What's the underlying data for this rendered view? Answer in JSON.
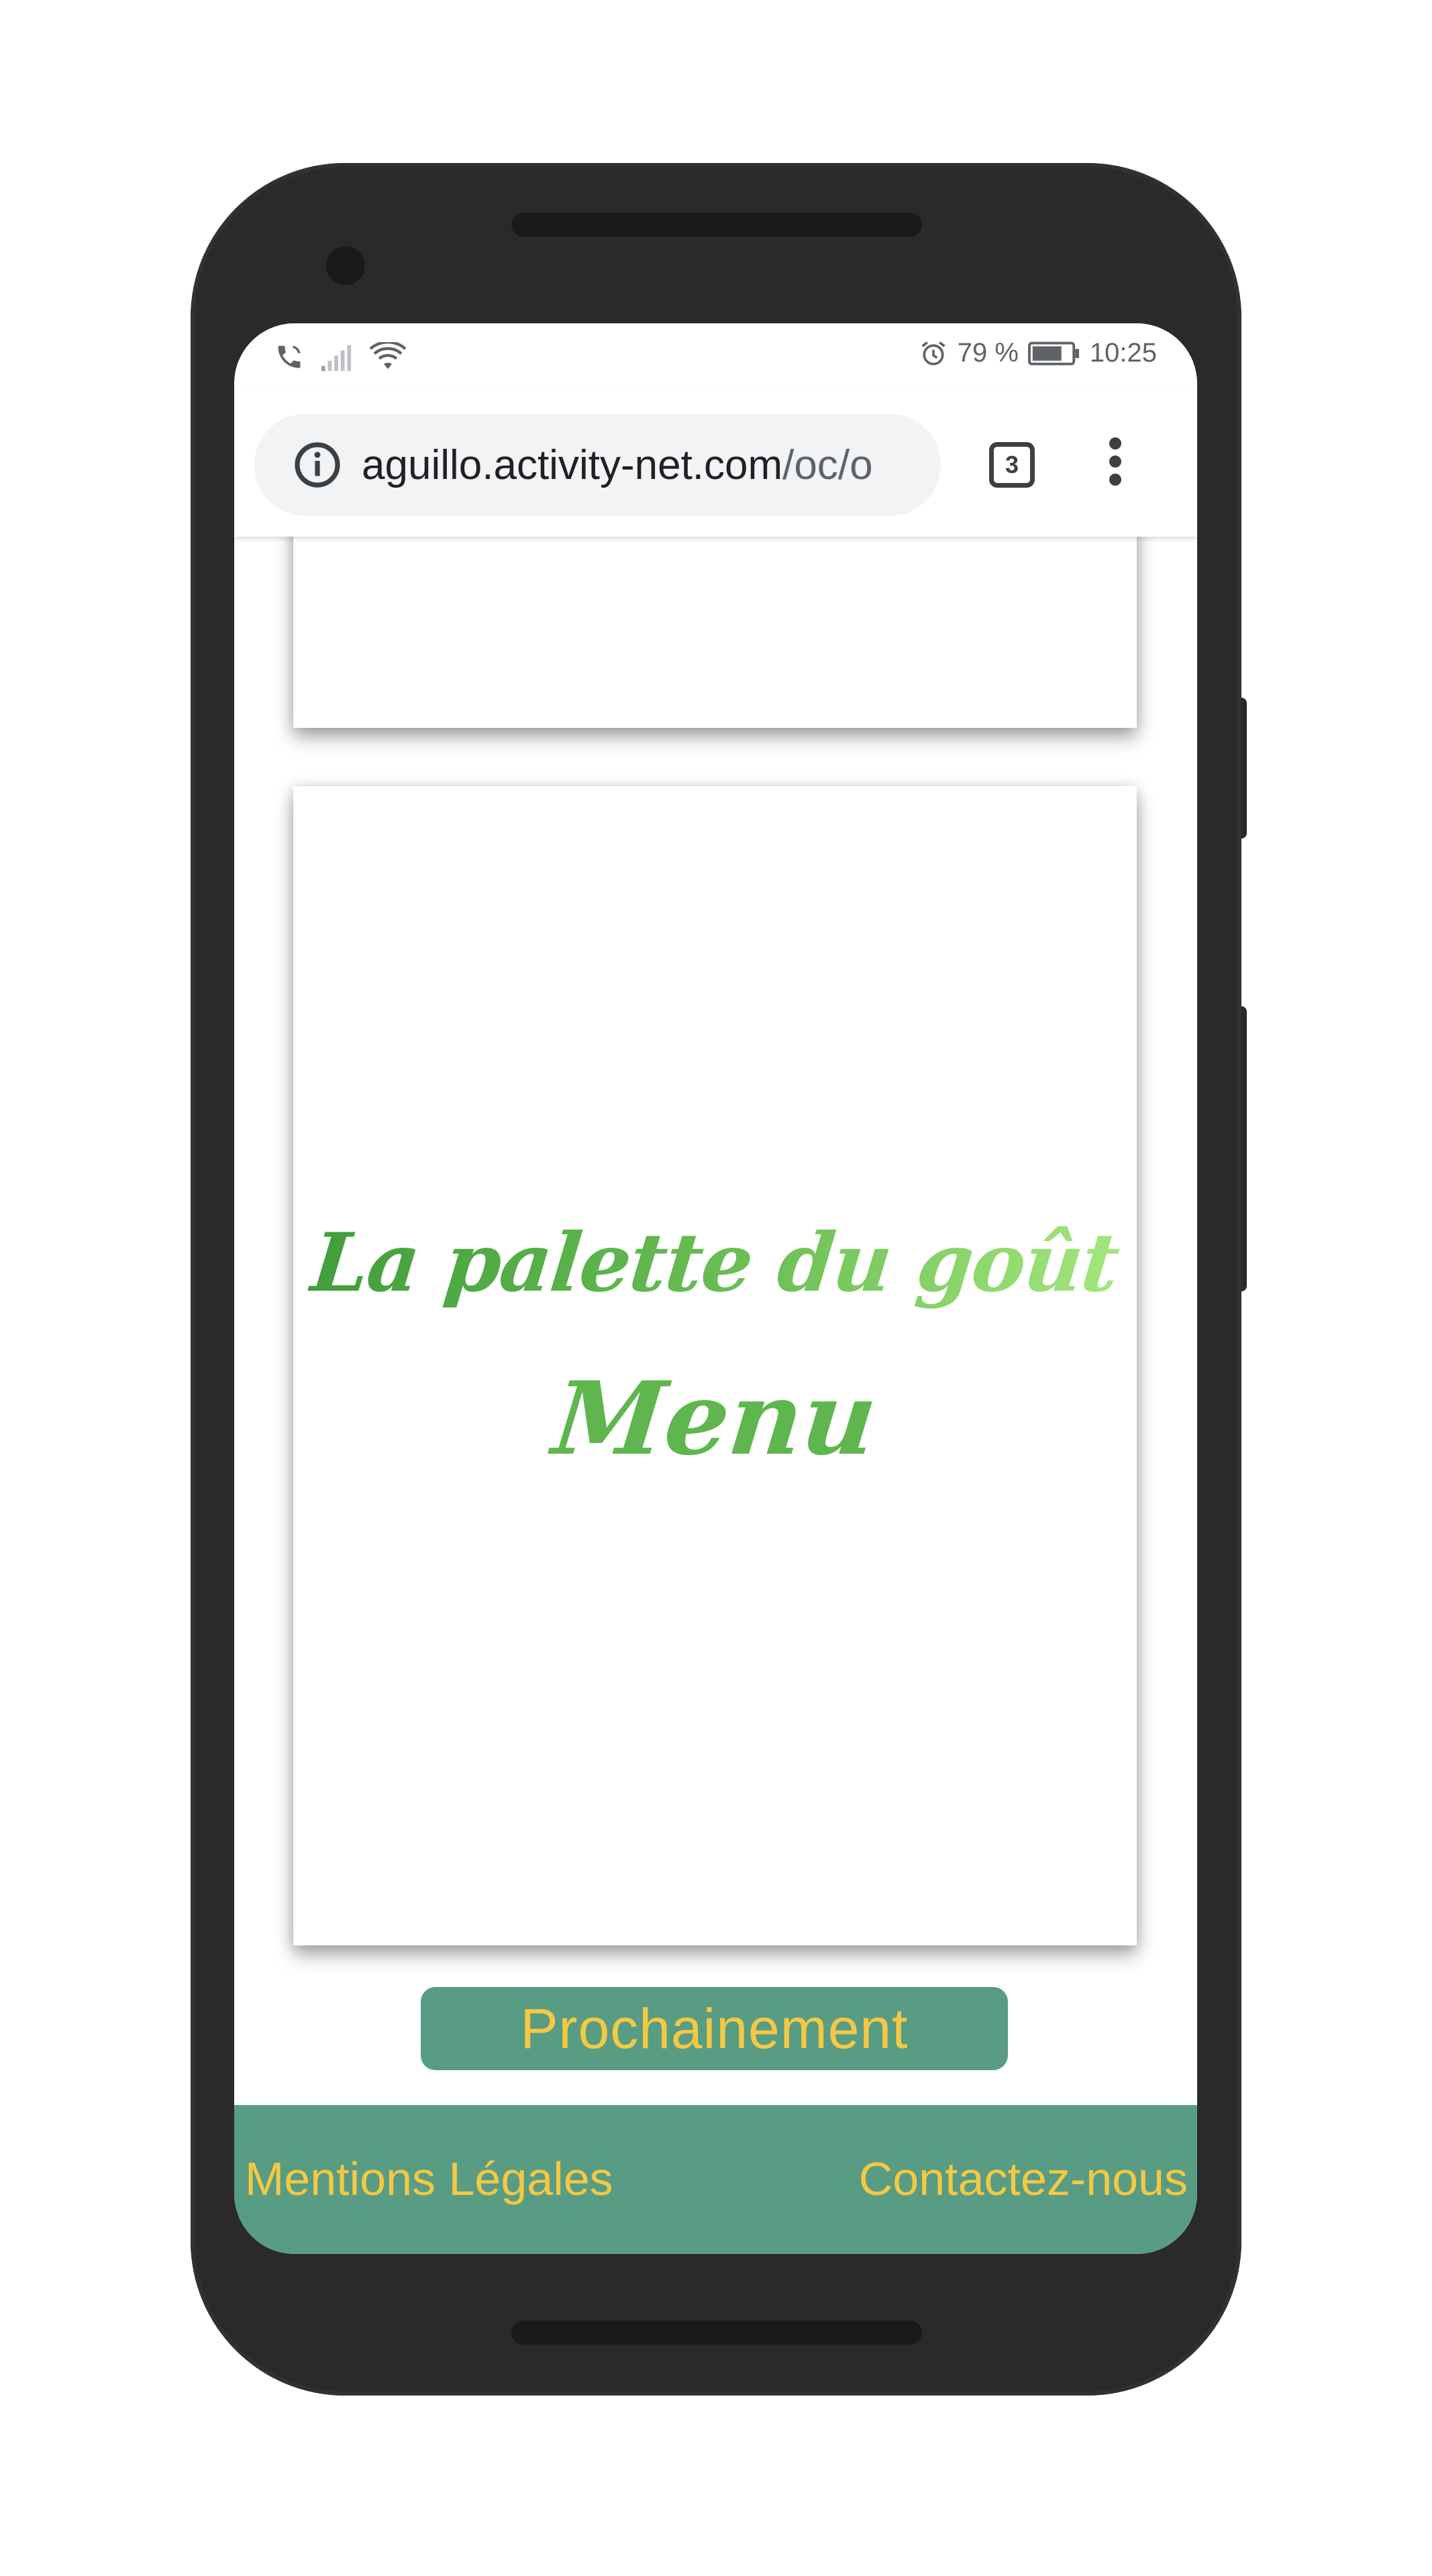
{
  "status_bar": {
    "battery": "79 %",
    "time": "10:25",
    "icons": [
      "wifi-calling-icon",
      "signal-icon",
      "wifi-icon",
      "alarm-icon",
      "battery-icon"
    ]
  },
  "browser": {
    "url_host": "aguillo.activity-net.com",
    "url_path": "/oc/o",
    "tab_count": "3",
    "icons": [
      "info-icon",
      "tab-switcher-icon",
      "overflow-menu-icon"
    ]
  },
  "page": {
    "menu_card": {
      "title": "La palette du goût",
      "subtitle": "Menu"
    },
    "soon_button": "Prochainement",
    "footer": {
      "legal_link": "Mentions Légales",
      "contact_link": "Contactez-nous"
    }
  },
  "colors": {
    "accent_green": "#589c84",
    "link_yellow": "#f5c842",
    "title_green_start": "#3f9d3a",
    "title_green_end": "#a6e87e"
  }
}
